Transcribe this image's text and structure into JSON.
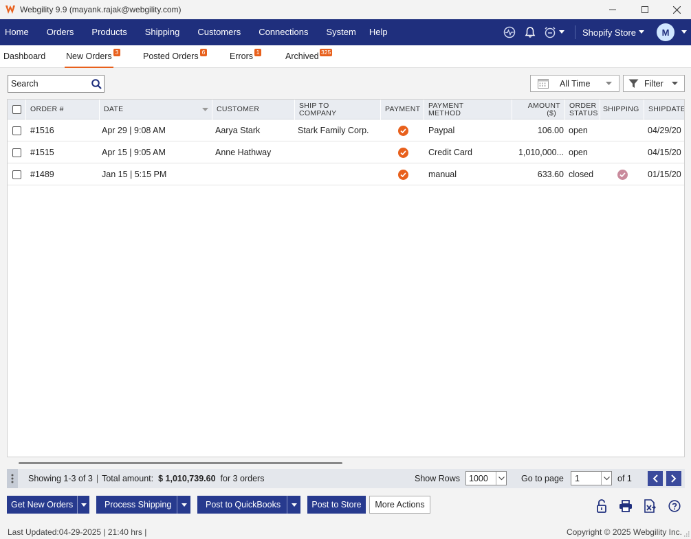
{
  "window": {
    "title": "Webgility 9.9 (mayank.rajak@webgility.com)"
  },
  "nav": {
    "items": [
      "Home",
      "Orders",
      "Products",
      "Shipping",
      "Customers",
      "Connections",
      "System",
      "Help"
    ],
    "store": "Shopify Store",
    "avatar_initial": "M"
  },
  "tabs": [
    {
      "label": "Dashboard",
      "badge": null
    },
    {
      "label": "New Orders",
      "badge": "3"
    },
    {
      "label": "Posted Orders",
      "badge": "6"
    },
    {
      "label": "Errors",
      "badge": "1"
    },
    {
      "label": "Archived",
      "badge": "325"
    }
  ],
  "toolbar": {
    "search_placeholder": "Search",
    "date_filter": "All Time",
    "filter_label": "Filter"
  },
  "table": {
    "headers": {
      "order": "ORDER #",
      "date": "DATE",
      "customer": "CUSTOMER",
      "ship_to_1": "SHIP TO",
      "ship_to_2": "COMPANY",
      "payment": "PAYMENT",
      "payment_method_1": "PAYMENT",
      "payment_method_2": "METHOD",
      "amount_1": "AMOUNT",
      "amount_2": "($)",
      "order_status_1": "ORDER",
      "order_status_2": "STATUS",
      "shipping": "SHIPPING",
      "shipdate": "SHIPDATE"
    },
    "rows": [
      {
        "order": "#1516",
        "date": "Apr 29 | 9:08 AM",
        "customer": "Aarya Stark",
        "company": "Stark Family Corp.",
        "payment_ok": true,
        "method": "Paypal",
        "amount": "106.00",
        "status": "open",
        "shipped": false,
        "shipdate": "04/29/20"
      },
      {
        "order": "#1515",
        "date": "Apr 15 | 9:05 AM",
        "customer": "Anne Hathway",
        "company": "",
        "payment_ok": true,
        "method": "Credit Card",
        "amount": "1,010,000...",
        "status": "open",
        "shipped": false,
        "shipdate": "04/15/20"
      },
      {
        "order": "#1489",
        "date": "Jan 15 | 5:15 PM",
        "customer": "",
        "company": "",
        "payment_ok": true,
        "method": "manual",
        "amount": "633.60",
        "status": "closed",
        "shipped": true,
        "shipdate": "01/15/20"
      }
    ]
  },
  "footer": {
    "showing": "Showing 1-3 of 3",
    "total_label": "Total amount:",
    "total_value": "$ 1,010,739.60",
    "total_suffix": "for 3 orders",
    "show_rows_label": "Show Rows",
    "show_rows_value": "1000",
    "goto_label": "Go to page",
    "goto_value": "1",
    "of_label": "of 1"
  },
  "actions": {
    "get_new_orders": "Get New Orders",
    "process_shipping": "Process Shipping",
    "post_to_quickbooks": "Post to QuickBooks",
    "post_to_store": "Post to Store",
    "more_actions": "More Actions"
  },
  "status": {
    "last_updated": "Last Updated:04-29-2025 | 21:40 hrs |",
    "copyright": "Copyright © 2025 Webgility Inc."
  },
  "colors": {
    "nav_bg": "#1f2f7d",
    "accent": "#e8601c",
    "button_bg": "#273a8e"
  }
}
